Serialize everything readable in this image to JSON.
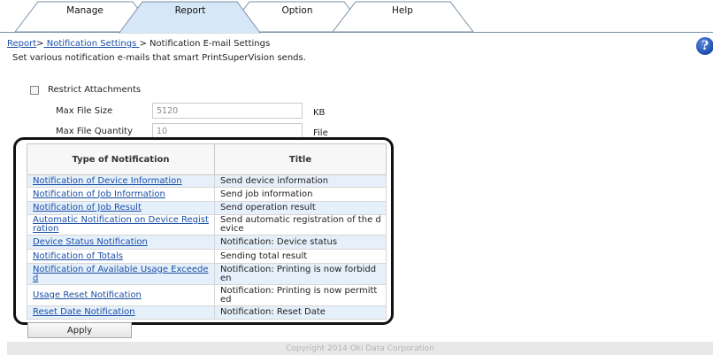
{
  "tabs": [
    {
      "label": "Manage",
      "active": false
    },
    {
      "label": "Report",
      "active": true
    },
    {
      "label": "Option",
      "active": false
    },
    {
      "label": "Help",
      "active": false
    }
  ],
  "breadcrumb": {
    "link1": "Report",
    "sep1": ">",
    "link2": " Notification Settings ",
    "sep2": ">",
    "current": " Notification E-mail Settings"
  },
  "description": "Set various notification e-mails that smart PrintSuperVision sends.",
  "help_icon": {
    "glyph": "?",
    "icon": "help-icon"
  },
  "restrict": {
    "label": "Restrict Attachments",
    "checked": false,
    "max_file_size": {
      "label": "Max File Size",
      "value": "5120",
      "unit": "KB"
    },
    "max_file_quantity": {
      "label": "Max File Quantity",
      "value": "10",
      "unit": "File"
    }
  },
  "table": {
    "headers": [
      "Type of Notification",
      "Title"
    ],
    "rows": [
      {
        "type": "Notification of Device Information",
        "title": "Send device information"
      },
      {
        "type": "Notification of Job Information",
        "title": "Send job information"
      },
      {
        "type": "Notification of Job Result",
        "title": "Send operation result"
      },
      {
        "type": "Automatic Notification on Device Registration",
        "title": "Send automatic registration of the device"
      },
      {
        "type": "Device Status Notification",
        "title": "Notification: Device status"
      },
      {
        "type": "Notification of Totals",
        "title": "Sending total result"
      },
      {
        "type": "Notification of Available Usage Exceeded",
        "title": "Notification: Printing is now forbidden"
      },
      {
        "type": "Usage Reset Notification",
        "title": "Notification: Printing is now permitted"
      },
      {
        "type": "Reset Date Notification",
        "title": "Notification: Reset Date"
      }
    ]
  },
  "apply_label": "Apply",
  "copyright": "Copyright 2014 Oki Data Corporation",
  "colors": {
    "link": "#1a4fa5",
    "active_tab": "#d6e8f7",
    "row_alt": "#e6f0fb",
    "help": "#1d4bab"
  }
}
